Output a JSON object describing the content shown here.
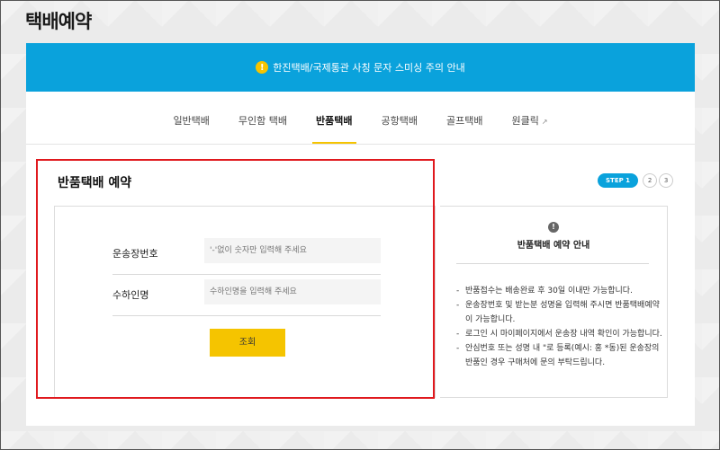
{
  "page": {
    "title": "택배예약"
  },
  "notice": {
    "icon": "!",
    "text": "한진택배/국제통관 사칭 문자 스미싱 주의 안내"
  },
  "tabs": [
    {
      "label": "일반택배"
    },
    {
      "label": "무인함 택배"
    },
    {
      "label": "반품택배"
    },
    {
      "label": "공항택배"
    },
    {
      "label": "골프택배"
    },
    {
      "label": "원클릭"
    }
  ],
  "active_tab": "반품택배",
  "ext_icon": "↗",
  "section": {
    "title": "반품택배 예약"
  },
  "steps": {
    "active": "STEP 1",
    "s2": "2",
    "s3": "3"
  },
  "form": {
    "tracking_label": "운송장번호",
    "tracking_placeholder": "'-'없이 숫자만 입력해 주세요",
    "recipient_label": "수하인명",
    "recipient_placeholder": "수하인명을 입력해 주세요",
    "search_label": "조회"
  },
  "info": {
    "icon": "!",
    "title": "반품택배 예약 안내",
    "items": [
      "반품접수는 배송완료 후 30일 이내만 가능합니다.",
      "운송장번호 및 받는분 성명을 입력해 주시면 반품택배예약이 가능합니다.",
      "로그인 시 마이페이지에서 운송장 내역 확인이 가능합니다.",
      "안심번호 또는 성명 내 \"로 등록(예시: 홍 *동)된 운송장의 반품인 경우 구매처에 문의 부탁드립니다."
    ]
  },
  "colors": {
    "accent": "#0aa2dc",
    "button": "#f5c400",
    "highlight": "#e0191e"
  }
}
